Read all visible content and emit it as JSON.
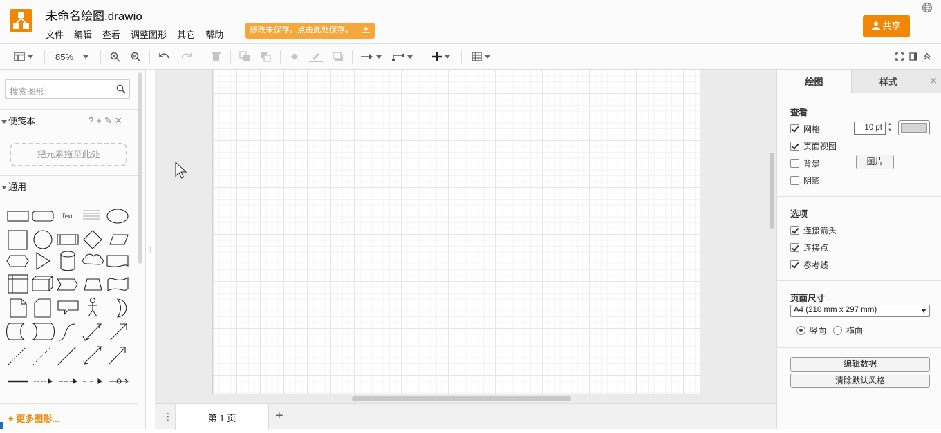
{
  "header": {
    "doc_title": "未命名绘图.drawio",
    "menus": [
      "文件",
      "编辑",
      "查看",
      "调整图形",
      "其它",
      "帮助"
    ],
    "save_banner": "修改未保存。点击此处保存。",
    "share_label": "共享"
  },
  "toolbar": {
    "zoom": "85%"
  },
  "sidebar": {
    "search_placeholder": "搜索图形",
    "scratchpad_title": "便笺本",
    "scratchpad_tools": [
      "?",
      "+",
      "✎",
      "✕"
    ],
    "drop_hint": "把元素拖至此处",
    "general_title": "通用",
    "text_shape_label": "Text",
    "more_shapes": "更多图形..."
  },
  "pages": {
    "tabs": [
      "第 1 页"
    ]
  },
  "format_panel": {
    "tab_diagram": "绘图",
    "tab_style": "样式",
    "view_title": "查看",
    "view_options": [
      {
        "label": "网格",
        "checked": true
      },
      {
        "label": "页面视图",
        "checked": true
      },
      {
        "label": "背景",
        "checked": false
      },
      {
        "label": "阴影",
        "checked": false
      }
    ],
    "grid_size": "10 pt",
    "image_button": "图片",
    "options_title": "选项",
    "options": [
      {
        "label": "连接箭头",
        "checked": true
      },
      {
        "label": "连接点",
        "checked": true
      },
      {
        "label": "参考线",
        "checked": true
      }
    ],
    "paper_title": "页面尺寸",
    "paper_size": "A4 (210 mm x 297 mm)",
    "orientation_portrait": "竖向",
    "orientation_landscape": "横向",
    "edit_data_button": "编辑数据",
    "clear_style_button": "清除默认风格"
  },
  "colors": {
    "brand": "#f08705",
    "banner": "#f5a73b",
    "grid_color": "#d4d4d4"
  }
}
